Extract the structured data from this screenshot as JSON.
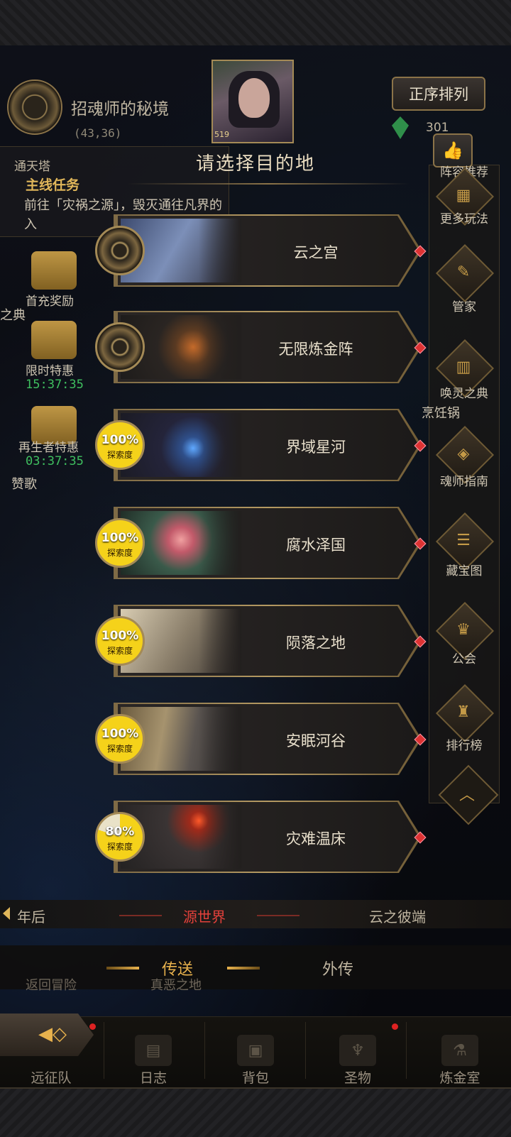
{
  "header": {
    "map_title": "招魂师的秘境",
    "coords": "(43,36)",
    "portrait_level": "519",
    "sort_button": "正序排列",
    "gem_count": "301"
  },
  "quest": {
    "tower": "通天塔",
    "title": "主线任务",
    "desc": "前往「灾祸之源」，毁灭通往凡界的入"
  },
  "left_menu": [
    {
      "label": "首充奖励"
    },
    {
      "label": "限时特惠",
      "timer": "15:37:35"
    },
    {
      "label": "再生者特惠",
      "timer": "03:37:35"
    }
  ],
  "left_fragments": {
    "dian": "之典",
    "zange": "赞歌"
  },
  "right_menu": [
    {
      "label": "阵容推荐",
      "icon": "thumbs-up-icon"
    },
    {
      "label": "更多玩法",
      "icon": "gift-icon"
    },
    {
      "label": "管家",
      "icon": "quill-icon"
    },
    {
      "label": "唤灵之典",
      "icon": "book-icon"
    },
    {
      "label": "魂师指南",
      "icon": "shield-icon"
    },
    {
      "label": "藏宝图",
      "icon": "map-icon"
    },
    {
      "label": "公会",
      "icon": "guild-icon"
    },
    {
      "label": "排行榜",
      "icon": "trophy-icon"
    }
  ],
  "right_fragments": {
    "pengren": "烹饪锅"
  },
  "dialog": {
    "title": "请选择目的地",
    "destinations": [
      {
        "name": "云之宫",
        "explored": null
      },
      {
        "name": "无限炼金阵",
        "explored": null
      },
      {
        "name": "界域星河",
        "explored": "100%",
        "explored_label": "探索度",
        "fill": 1.0
      },
      {
        "name": "腐水泽国",
        "explored": "100%",
        "explored_label": "探索度",
        "fill": 1.0
      },
      {
        "name": "陨落之地",
        "explored": "100%",
        "explored_label": "探索度",
        "fill": 1.0
      },
      {
        "name": "安眠河谷",
        "explored": "100%",
        "explored_label": "探索度",
        "fill": 1.0
      },
      {
        "name": "灾难温床",
        "explored": "80%",
        "explored_label": "探索度",
        "fill": 0.8
      }
    ]
  },
  "world_tabs": {
    "prev": "年后",
    "current": "源世界",
    "next": "云之彼端"
  },
  "sub_tabs": {
    "send": "传送",
    "ext": "外传"
  },
  "ghost": {
    "back": "返回冒险",
    "land": "真恶之地"
  },
  "bottom_nav": [
    {
      "label": "远征队",
      "dot": true
    },
    {
      "label": "日志",
      "dot": false
    },
    {
      "label": "背包",
      "dot": false
    },
    {
      "label": "圣物",
      "dot": true
    },
    {
      "label": "炼金室",
      "dot": false
    }
  ]
}
